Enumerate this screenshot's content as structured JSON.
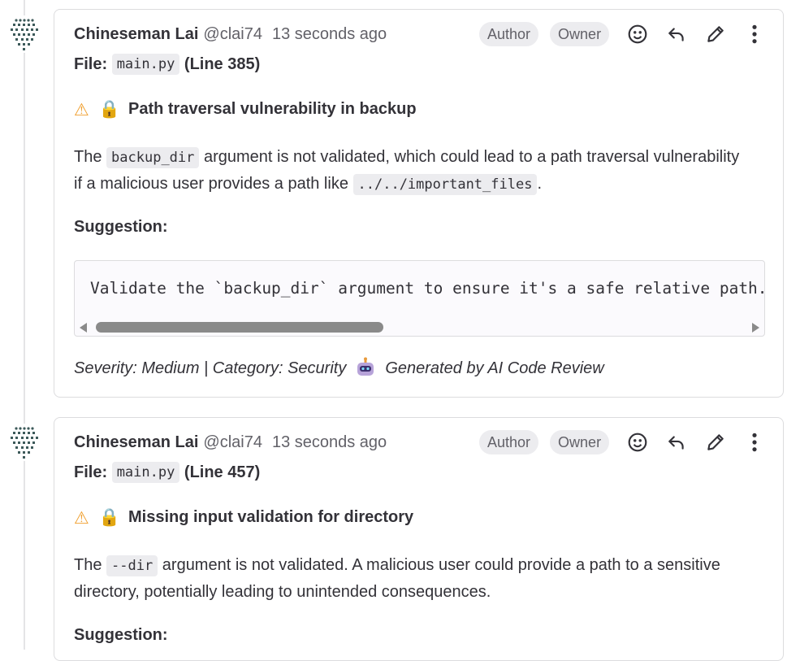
{
  "notes": [
    {
      "author_name": "Chineseman Lai",
      "author_handle": "@clai74",
      "timestamp": "13 seconds ago",
      "badges": [
        "Author",
        "Owner"
      ],
      "file_label": "File:",
      "file_name": "main.py",
      "file_line": "(Line 385)",
      "title": "Path traversal vulnerability in backup",
      "body_pre": "The",
      "body_code": "backup_dir",
      "body_mid": "argument is not validated, which could lead to a path traversal vulnerability if a malicious user provides a path like",
      "body_code2": "../../important_files",
      "body_post": ".",
      "suggestion_label": "Suggestion:",
      "suggestion_code": "Validate the `backup_dir` argument to ensure it's a safe relative path.",
      "footer_meta": "Severity: Medium | Category: Security",
      "footer_generated": "Generated by AI Code Review"
    },
    {
      "author_name": "Chineseman Lai",
      "author_handle": "@clai74",
      "timestamp": "13 seconds ago",
      "badges": [
        "Author",
        "Owner"
      ],
      "file_label": "File:",
      "file_name": "main.py",
      "file_line": "(Line 457)",
      "title": "Missing input validation for directory",
      "body_pre": "The",
      "body_code": "--dir",
      "body_mid": "argument is not validated. A malicious user could provide a path to a sensitive directory, potentially leading to unintended consequences.",
      "suggestion_label": "Suggestion:"
    }
  ],
  "icons": {
    "warning": "warning-icon",
    "lock": "lock-icon",
    "emoji": "smiley-icon",
    "reply": "reply-icon",
    "edit": "pencil-icon",
    "more": "more-vertical-icon",
    "robot": "robot-icon"
  },
  "emoji_glyphs": {
    "warning": "⚠",
    "lock": "🔒"
  }
}
